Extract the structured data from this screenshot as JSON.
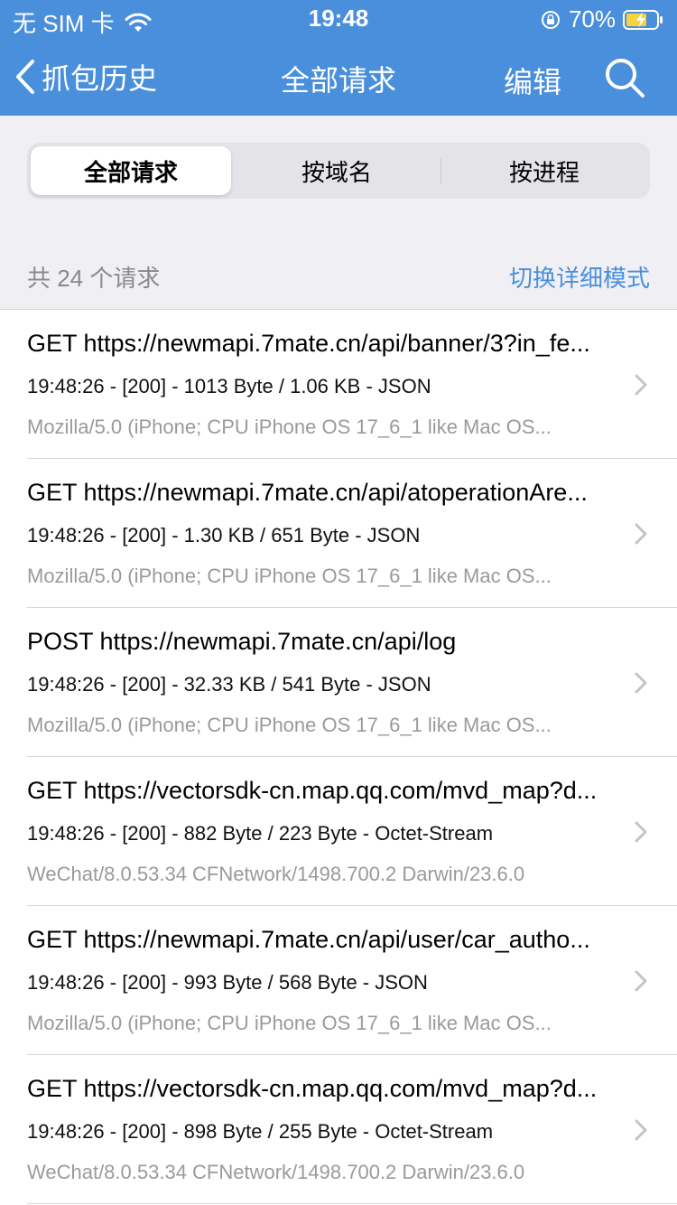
{
  "status_bar": {
    "carrier": "无 SIM 卡",
    "time": "19:48",
    "battery_percent": "70%"
  },
  "nav": {
    "back_label": "抓包历史",
    "title": "全部请求",
    "edit_label": "编辑",
    "search_icon": "search-icon"
  },
  "segments": [
    {
      "label": "全部请求",
      "selected": true
    },
    {
      "label": "按域名",
      "selected": false
    },
    {
      "label": "按进程",
      "selected": false
    }
  ],
  "summary": {
    "count_text": "共 24 个请求",
    "switch_mode_label": "切换详细模式"
  },
  "requests": [
    {
      "title": "GET https://newmapi.7mate.cn/api/banner/3?in_fe...",
      "meta": "19:48:26 - [200] - 1013 Byte / 1.06 KB - JSON",
      "user_agent": "Mozilla/5.0 (iPhone; CPU iPhone OS 17_6_1 like Mac OS..."
    },
    {
      "title": "GET https://newmapi.7mate.cn/api/atoperationAre...",
      "meta": "19:48:26 - [200] - 1.30 KB / 651 Byte - JSON",
      "user_agent": "Mozilla/5.0 (iPhone; CPU iPhone OS 17_6_1 like Mac OS..."
    },
    {
      "title": "POST https://newmapi.7mate.cn/api/log",
      "meta": "19:48:26 - [200] - 32.33 KB / 541 Byte - JSON",
      "user_agent": "Mozilla/5.0 (iPhone; CPU iPhone OS 17_6_1 like Mac OS..."
    },
    {
      "title": "GET https://vectorsdk-cn.map.qq.com/mvd_map?d...",
      "meta": "19:48:26 - [200] - 882 Byte / 223 Byte - Octet-Stream",
      "user_agent": "WeChat/8.0.53.34 CFNetwork/1498.700.2 Darwin/23.6.0"
    },
    {
      "title": "GET https://newmapi.7mate.cn/api/user/car_autho...",
      "meta": "19:48:26 - [200] - 993 Byte / 568 Byte - JSON",
      "user_agent": "Mozilla/5.0 (iPhone; CPU iPhone OS 17_6_1 like Mac OS..."
    },
    {
      "title": "GET https://vectorsdk-cn.map.qq.com/mvd_map?d...",
      "meta": "19:48:26 - [200] - 898 Byte / 255 Byte - Octet-Stream",
      "user_agent": "WeChat/8.0.53.34 CFNetwork/1498.700.2 Darwin/23.6.0"
    }
  ],
  "colors": {
    "nav_background": "#4a8fdc",
    "accent": "#4a8fdc",
    "list_background": "#ffffff",
    "gray_background": "#efeff4"
  }
}
